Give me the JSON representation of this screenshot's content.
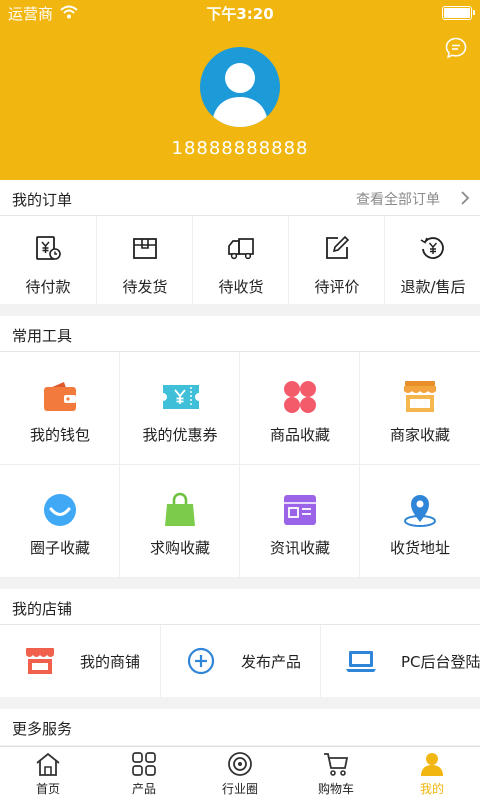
{
  "status": {
    "carrier": "运营商",
    "time": "下午3:20"
  },
  "profile": {
    "phone": "18888888888"
  },
  "orders": {
    "title": "我的订单",
    "view_all": "查看全部订单",
    "items": [
      {
        "label": "待付款",
        "icon": "wallet-clock-icon"
      },
      {
        "label": "待发货",
        "icon": "box-icon"
      },
      {
        "label": "待收货",
        "icon": "truck-icon"
      },
      {
        "label": "待评价",
        "icon": "edit-icon"
      },
      {
        "label": "退款/售后",
        "icon": "refund-icon"
      }
    ]
  },
  "tools": {
    "title": "常用工具",
    "items": [
      {
        "label": "我的钱包",
        "icon": "wallet-icon"
      },
      {
        "label": "我的优惠券",
        "icon": "coupon-icon"
      },
      {
        "label": "商品收藏",
        "icon": "clover-icon"
      },
      {
        "label": "商家收藏",
        "icon": "store-icon"
      },
      {
        "label": "圈子收藏",
        "icon": "smile-circle-icon"
      },
      {
        "label": "求购收藏",
        "icon": "shopping-bag-icon"
      },
      {
        "label": "资讯收藏",
        "icon": "news-icon"
      },
      {
        "label": "收货地址",
        "icon": "location-pin-icon"
      }
    ]
  },
  "shop": {
    "title": "我的店铺",
    "items": [
      {
        "label": "我的商铺",
        "icon": "storefront-icon"
      },
      {
        "label": "发布产品",
        "icon": "add-circle-icon"
      },
      {
        "label": "PC后台登陆",
        "icon": "laptop-icon"
      }
    ]
  },
  "more": {
    "title": "更多服务"
  },
  "tabbar": {
    "items": [
      {
        "label": "首页",
        "icon": "home-icon"
      },
      {
        "label": "产品",
        "icon": "grid-icon"
      },
      {
        "label": "行业圈",
        "icon": "circle-icon"
      },
      {
        "label": "购物车",
        "icon": "cart-icon"
      },
      {
        "label": "我的",
        "icon": "user-icon"
      }
    ],
    "active_index": 4
  },
  "colors": {
    "accent": "#f1b60f",
    "avatar_bg": "#1d9ad8",
    "muted": "#8a8a8a"
  }
}
